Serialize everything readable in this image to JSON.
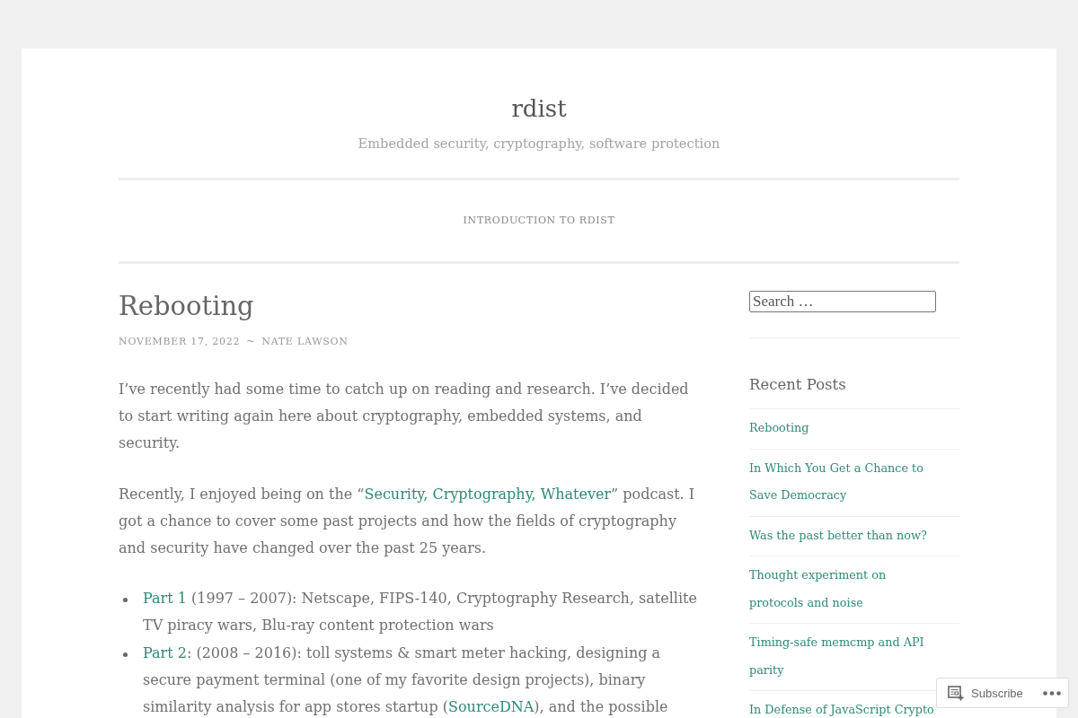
{
  "site": {
    "title": "rdist",
    "tagline": "Embedded security, cryptography, software protection"
  },
  "nav": [
    {
      "label": "INTRODUCTION TO RDIST"
    }
  ],
  "post": {
    "title": "Rebooting",
    "date": "NOVEMBER 17, 2022",
    "separator": "~",
    "author": "NATE LAWSON",
    "paragraphs": [
      [
        {
          "kind": "text",
          "text": "I’ve recently had some time to catch up on reading and research. I’ve decided to start writing again here about cryptography, embedded systems, and security."
        }
      ],
      [
        {
          "kind": "text",
          "text": "Recently, I enjoyed being on the “"
        },
        {
          "kind": "link",
          "text": "Security, Cryptography, Whatever"
        },
        {
          "kind": "text",
          "text": "” podcast. I got a chance to cover some past projects and how the fields of cryptography and security have changed over the past 25 years."
        }
      ]
    ],
    "list": [
      [
        {
          "kind": "link",
          "text": "Part 1"
        },
        {
          "kind": "text",
          "text": " (1997 – 2007): Netscape, FIPS-140, Cryptography Research, satellite TV piracy wars, Blu-ray content protection wars"
        }
      ],
      [
        {
          "kind": "link",
          "text": "Part 2"
        },
        {
          "kind": "text",
          "text": ": (2008 – 2016): toll systems & smart meter hacking, designing a secure payment terminal (one of my favorite design projects), binary similarity analysis for app stores startup ("
        },
        {
          "kind": "link",
          "text": "SourceDNA"
        },
        {
          "kind": "text",
          "text": "), and the possible"
        }
      ]
    ]
  },
  "sidebar": {
    "search": {
      "placeholder": "Search …"
    },
    "recent_posts": {
      "title": "Recent Posts",
      "items": [
        "Rebooting",
        "In Which You Get a Chance to Save Democracy",
        "Was the past better than now?",
        "Thought experiment on protocols and noise",
        "Timing-safe memcmp and API parity",
        "In Defense of JavaScript Crypto"
      ]
    }
  },
  "subscribe_bar": {
    "label": "Subscribe"
  }
}
